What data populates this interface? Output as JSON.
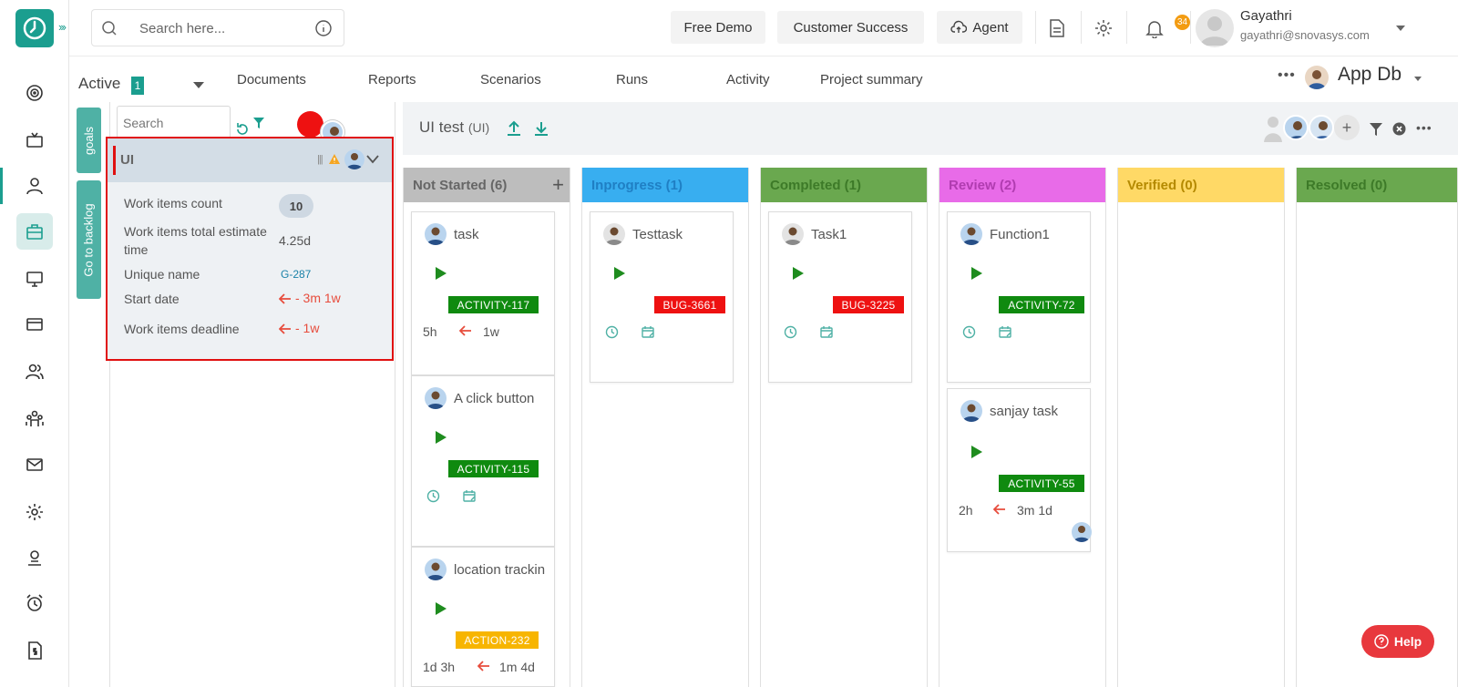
{
  "search": {
    "placeholder": "Search here..."
  },
  "topbar": {
    "free_demo": "Free Demo",
    "customer_success": "Customer Success",
    "agent": "Agent",
    "notification_count": "34",
    "user_name": "Gayathri",
    "user_email": "gayathri@snovasys.com"
  },
  "subnav": {
    "active_label": "Active",
    "active_count": "1",
    "tabs": [
      "Documents",
      "Reports",
      "Scenarios",
      "Runs",
      "Activity",
      "Project summary"
    ],
    "project": "App Db"
  },
  "sidetabs": {
    "goals": "goals",
    "backlog": "Go to backlog"
  },
  "panel": {
    "search_placeholder": "Search"
  },
  "goal": {
    "title": "UI",
    "count_label": "Work items count",
    "count": "10",
    "estimate_label": "Work items total estimate time",
    "estimate": "4.25d",
    "unique_label": "Unique name",
    "unique": "G-287",
    "start_label": "Start date",
    "start": "- 3m 1w",
    "deadline_label": "Work items deadline",
    "deadline": "- 1w"
  },
  "board": {
    "title": "UI test",
    "title_suffix": "(UI)"
  },
  "columns": [
    {
      "label": "Not Started (6)",
      "color": "#bdbdbd",
      "text": "#666666"
    },
    {
      "label": "Inprogress (1)",
      "color": "#38aef0",
      "text": "#1f7fc4"
    },
    {
      "label": "Completed (1)",
      "color": "#6aa84f",
      "text": "#3d7a28"
    },
    {
      "label": "Review (2)",
      "color": "#e86be8",
      "text": "#b03cb0"
    },
    {
      "label": "Verified (0)",
      "color": "#ffd966",
      "text": "#b58a00"
    },
    {
      "label": "Resolved (0)",
      "color": "#6aa84f",
      "text": "#3d7a28"
    }
  ],
  "cards": {
    "c1": {
      "title": "task",
      "tag": "ACTIVITY-117",
      "time": "5h",
      "due": "1w"
    },
    "c2": {
      "title": "A click button",
      "tag": "ACTIVITY-115"
    },
    "c3": {
      "title": "location trackin",
      "tag": "ACTION-232",
      "time": "1d 3h",
      "due": "1m 4d"
    },
    "c4": {
      "title": "Testtask",
      "tag": "BUG-3661"
    },
    "c5": {
      "title": "Task1",
      "tag": "BUG-3225"
    },
    "c6": {
      "title": "Function1",
      "tag": "ACTIVITY-72"
    },
    "c7": {
      "title": "sanjay task",
      "tag": "ACTIVITY-55",
      "time": "2h",
      "due": "3m 1d"
    }
  },
  "help": {
    "label": "Help"
  }
}
